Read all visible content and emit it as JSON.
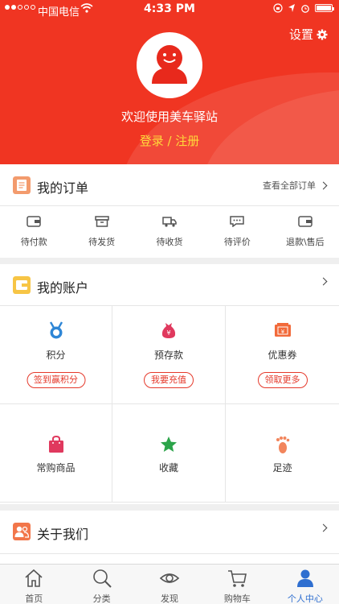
{
  "status_bar": {
    "carrier": "中国电信",
    "time": "4:33 PM"
  },
  "header": {
    "settings_label": "设置",
    "welcome": "欢迎使用美车驿站",
    "login_label": "登录 / 注册"
  },
  "orders": {
    "title": "我的订单",
    "view_all": "查看全部订单",
    "items": [
      {
        "label": "待付款",
        "icon": "wallet-icon"
      },
      {
        "label": "待发货",
        "icon": "box-icon"
      },
      {
        "label": "待收货",
        "icon": "truck-icon"
      },
      {
        "label": "待评价",
        "icon": "comment-icon"
      },
      {
        "label": "退款\\售后",
        "icon": "refund-icon"
      }
    ]
  },
  "account": {
    "title": "我的账户",
    "cells": [
      {
        "label": "积分",
        "button": "签到赢积分",
        "icon": "medal-icon"
      },
      {
        "label": "预存款",
        "button": "我要充值",
        "icon": "money-bag-icon"
      },
      {
        "label": "优惠券",
        "button": "领取更多",
        "icon": "coupon-icon"
      },
      {
        "label": "常购商品",
        "icon": "shopping-bag-icon"
      },
      {
        "label": "收藏",
        "icon": "star-icon"
      },
      {
        "label": "足迹",
        "icon": "footprint-icon"
      }
    ]
  },
  "about": {
    "title": "关于我们"
  },
  "tabbar": {
    "items": [
      {
        "label": "首页",
        "icon": "home-icon"
      },
      {
        "label": "分类",
        "icon": "search-icon"
      },
      {
        "label": "发现",
        "icon": "eye-icon"
      },
      {
        "label": "购物车",
        "icon": "cart-icon"
      },
      {
        "label": "个人中心",
        "icon": "person-icon"
      }
    ],
    "active_index": 4
  },
  "colors": {
    "brand_red": "#f03522",
    "login_yellow": "#ffd93a",
    "tab_active_blue": "#2f6fd0"
  }
}
